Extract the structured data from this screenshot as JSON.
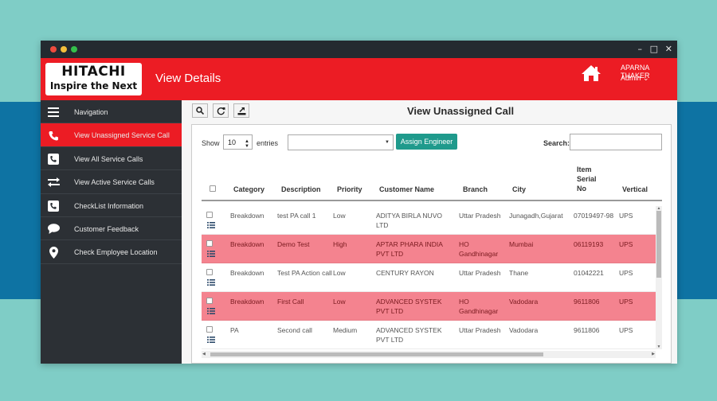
{
  "header": {
    "logo_main": "HITACHI",
    "logo_tagline": "Inspire the Next",
    "page_title": "View Details",
    "user_name": "APARNA THAKER",
    "user_role": "Admin ⌄",
    "brand_color": "#ec1c24"
  },
  "sidebar": {
    "items": [
      {
        "label": "Navigation",
        "icon": "menu-icon"
      },
      {
        "label": "View Unassigned Service Call",
        "icon": "phone-icon",
        "active": true
      },
      {
        "label": "View All Service Calls",
        "icon": "phone-square-icon"
      },
      {
        "label": "View Active Service Calls",
        "icon": "exchange-icon"
      },
      {
        "label": "CheckList Information",
        "icon": "phone-square-icon"
      },
      {
        "label": "Customer Feedback",
        "icon": "chat-bubble-icon"
      },
      {
        "label": "Check Employee Location",
        "icon": "map-marker-icon"
      }
    ]
  },
  "content": {
    "title": "View Unassigned Call",
    "toolbar": {
      "search": "search-icon",
      "refresh": "refresh-icon",
      "export": "export-icon"
    }
  },
  "controls": {
    "show_label": "Show",
    "entries_value": "10",
    "entries_label": "entries",
    "assign_button": "Assign Engineer",
    "assign_color": "#1f9a8c",
    "search_label": "Search:"
  },
  "table": {
    "headers": {
      "category": "Category",
      "description": "Description",
      "priority": "Priority",
      "customer": "Customer Name",
      "branch": "Branch",
      "city": "City",
      "serial_1": "Item",
      "serial_2": "Serial",
      "serial_3": "No",
      "vertical": "Vertical"
    },
    "highlight_color": "#f4838f",
    "rows": [
      {
        "category": "Breakdown",
        "description": "test PA call 1",
        "priority": "Low",
        "customer": "ADITYA BIRLA NUVO LTD",
        "branch": "Uttar Pradesh",
        "city": "Junagadh,Gujarat",
        "serial": "07019497-98",
        "vertical": "UPS",
        "highlighted": false
      },
      {
        "category": "Breakdown",
        "description": "Demo Test",
        "priority": "High",
        "customer": "APTAR PHARA INDIA PVT LTD",
        "branch": "HO Gandhinagar",
        "city": "Mumbai",
        "serial": "06119193",
        "vertical": "UPS",
        "highlighted": true
      },
      {
        "category": "Breakdown",
        "description": "Test PA Action call",
        "priority": "Low",
        "customer": "CENTURY RAYON",
        "branch": "Uttar Pradesh",
        "city": "Thane",
        "serial": "01042221",
        "vertical": "UPS",
        "highlighted": false
      },
      {
        "category": "Breakdown",
        "description": "First Call",
        "priority": "Low",
        "customer": "ADVANCED SYSTEK PVT LTD",
        "branch": "HO Gandhinagar",
        "city": "Vadodara",
        "serial": "9611806",
        "vertical": "UPS",
        "highlighted": true
      },
      {
        "category": "PA",
        "description": "Second call",
        "priority": "Medium",
        "customer": "ADVANCED SYSTEK PVT LTD",
        "branch": "Uttar Pradesh",
        "city": "Vadodara",
        "serial": "9611806",
        "vertical": "UPS",
        "highlighted": false
      }
    ]
  }
}
